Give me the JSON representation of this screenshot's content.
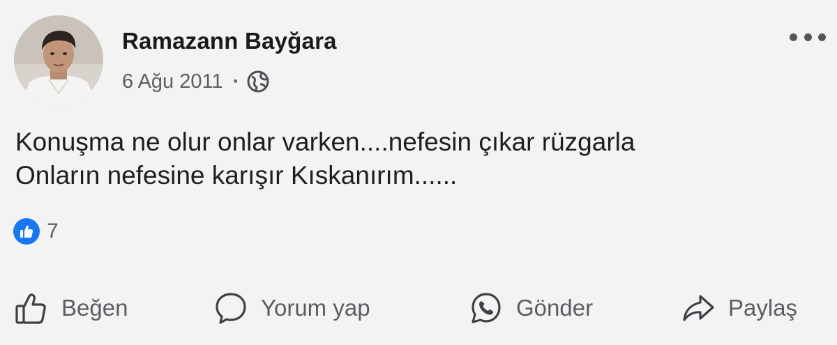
{
  "post": {
    "author": "Ramazann Bayğara",
    "date": "6 Ağu 2011",
    "separator": "·",
    "privacy_icon": "globe-icon",
    "text_lines": [
      "Konuşma ne olur onlar varken....nefesin çıkar rüzgarla",
      "Onların nefesine karışır Kıskanırım......"
    ],
    "reactions": {
      "icon": "like-icon",
      "count": "7"
    }
  },
  "actions": {
    "like_label": "Beğen",
    "comment_label": "Yorum yap",
    "send_label": "Gönder",
    "share_label": "Paylaş"
  },
  "colors": {
    "like_blue": "#1877f2",
    "secondary_text": "#5a5d62",
    "background": "#f3f3f3"
  }
}
